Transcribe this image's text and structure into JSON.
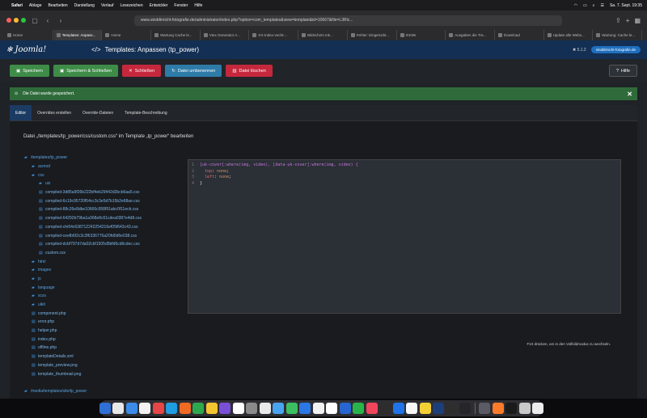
{
  "menubar": {
    "apple": "",
    "items": [
      "Safari",
      "Ablage",
      "Bearbeiten",
      "Darstellung",
      "Verlauf",
      "Lesezeichen",
      "Entwickler",
      "Fenster",
      "Hilfe"
    ],
    "datetime": "Sa. 7. Sept. 19:35"
  },
  "browser": {
    "url": "www.sinddirnicht-fotografie.de/administrator/index.php?option=com_templates&view=template&id=10667&file=L3Rlc...",
    "tabs": [
      "Home",
      "Templates: Anpass...",
      "Home",
      "Wartung Cache le...",
      "Vtex Generator A...",
      "KX-Index-vecht-...",
      "Bildschirm Ink...",
      "Fehler: Eingerückt...",
      "ICK96",
      "Ausgaben die Tra...",
      "Download",
      "Update alle Webs...",
      "Wartung: Cache le..."
    ],
    "active_tab": 1
  },
  "header": {
    "logo": "Joomla!",
    "title_icon": "</>",
    "title": "Templates: Anpassen (tp_power)",
    "version": "✖ 5.1.2",
    "site_button": "sinddirnicht-fotografie.de"
  },
  "toolbar": {
    "save": "Speichern",
    "save_close": "Speichern & Schließen",
    "close": "Schließen",
    "rename": "Datei umbenennen",
    "delete": "Datei löschen",
    "help": "Hilfe"
  },
  "alert": {
    "message": "Die Datei wurde gespeichert."
  },
  "tabs": [
    "Editor",
    "Overrides erstellen",
    "Override-Dateien",
    "Template-Beschreibung"
  ],
  "edit_heading": "Datei „/templates/tp_power/css/custom.css“ im Template „tp_power“ bearbeiten",
  "tree": [
    {
      "label": "/templates/tp_power",
      "type": "folder",
      "indent": 0
    },
    {
      "label": "acmod",
      "type": "folder",
      "indent": 1
    },
    {
      "label": "css",
      "type": "folder",
      "indent": 1
    },
    {
      "label": "uis",
      "type": "folder",
      "indent": 2
    },
    {
      "label": "compiled-3d85a9f26b222bf4eb29442d2bcb6aa5.css",
      "type": "file",
      "indent": 2
    },
    {
      "label": "compiled-6c19c95720f54cc3c3e5d7b15b2e68ae.css",
      "type": "file",
      "indent": 2
    },
    {
      "label": "compiled-88c26e8dbe10666c958f91abc0f11ecb.css",
      "type": "file",
      "indent": 2
    },
    {
      "label": "compiled-64292b79ba1a368e8c61cdea0387e4d8.css",
      "type": "file",
      "indent": 2
    },
    {
      "label": "compiled-cfe54c638712242254216ef05f643c43.css",
      "type": "file",
      "indent": 2
    },
    {
      "label": "compiled-ceefb6f2c3c3f6336776a20fd0d6e038.css",
      "type": "file",
      "indent": 2
    },
    {
      "label": "compiled-dcbf797d7da02cbf1505d5bfd6cd6cdec.css",
      "type": "file",
      "indent": 2
    },
    {
      "label": "custom.css",
      "type": "file",
      "indent": 2
    },
    {
      "label": "html",
      "type": "folder",
      "indent": 1
    },
    {
      "label": "images",
      "type": "folder",
      "indent": 1
    },
    {
      "label": "js",
      "type": "folder",
      "indent": 1
    },
    {
      "label": "language",
      "type": "folder",
      "indent": 1
    },
    {
      "label": "scss",
      "type": "folder",
      "indent": 1
    },
    {
      "label": "uikit",
      "type": "folder",
      "indent": 1
    },
    {
      "label": "component.php",
      "type": "file",
      "indent": 1
    },
    {
      "label": "error.php",
      "type": "file",
      "indent": 1
    },
    {
      "label": "helper.php",
      "type": "file",
      "indent": 1
    },
    {
      "label": "index.php",
      "type": "file",
      "indent": 1
    },
    {
      "label": "offline.php",
      "type": "file",
      "indent": 1
    },
    {
      "label": "templateDetails.xml",
      "type": "file",
      "indent": 1
    },
    {
      "label": "template_preview.png",
      "type": "file",
      "indent": 1
    },
    {
      "label": "template_thumbnail.png",
      "type": "file",
      "indent": 1
    },
    {
      "label": "",
      "type": "spacer",
      "indent": 0
    },
    {
      "label": "/media/templates/site/tp_power",
      "type": "folder",
      "indent": 0
    }
  ],
  "code": [
    {
      "n": "1",
      "parts": [
        [
          "sel",
          "[uk-cover]:where(img, video), [data-uk-cover]:where(img, video) {"
        ]
      ]
    },
    {
      "n": "2",
      "parts": [
        [
          "prop",
          "  top"
        ],
        [
          "plain",
          ": "
        ],
        [
          "val",
          "none"
        ],
        [
          "plain",
          ";"
        ]
      ]
    },
    {
      "n": "3",
      "parts": [
        [
          "prop",
          "  left"
        ],
        [
          "plain",
          ": "
        ],
        [
          "val",
          "none"
        ],
        [
          "plain",
          ";"
        ]
      ]
    },
    {
      "n": "4",
      "parts": [
        [
          "plain",
          "}"
        ]
      ]
    }
  ],
  "fullscreen_hint": "F10 drücken, um in den Vollbildmodus zu wechseln.",
  "dock": [
    "#2f6fd6",
    "#e8e8e8",
    "#3c8be8",
    "#f2f2f2",
    "#e64646",
    "#1f9de0",
    "#f06a24",
    "#2ea84c",
    "#f5c431",
    "#7a4fd8",
    "#ffffff",
    "#8a8a8a",
    "#e9e9e9",
    "#4aa3f0",
    "#3cbf60",
    "#2b78e4",
    "#f2f2f2",
    "#ffffff",
    "#2766d0",
    "#28b44a",
    "#f0455c",
    "#2d2d2d",
    "#1e74e8",
    "#f8f8f8",
    "#f4d035",
    "#1c3f7a",
    "#2e2e2e",
    "#25252a",
    "#5b5b66",
    "#ff7b2a",
    "#1a1a1a",
    "#c9c9c9",
    "#ececec"
  ]
}
